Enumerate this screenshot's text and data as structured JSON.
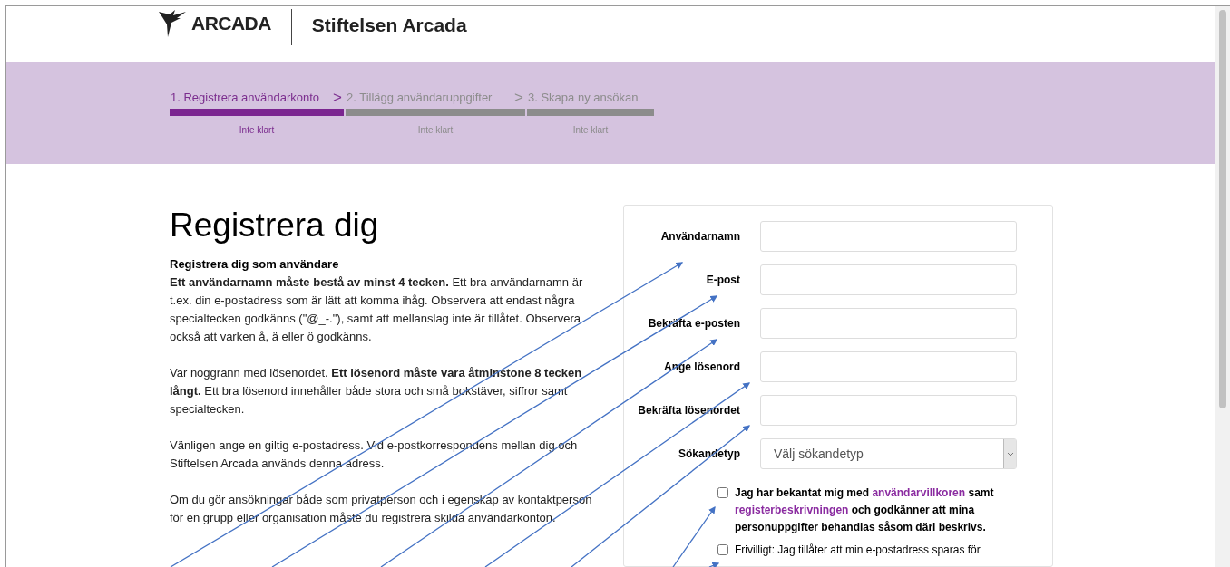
{
  "header": {
    "logo_text": "ARCADA",
    "title": "Stiftelsen Arcada"
  },
  "steps": [
    {
      "label": "1. Registrera användarkonto",
      "status": "Inte klart",
      "selected": true
    },
    {
      "label": "2. Tillägg användaruppgifter",
      "status": "Inte klart",
      "selected": false
    },
    {
      "label": "3. Skapa ny ansökan",
      "status": "Inte klart",
      "selected": false
    }
  ],
  "step_separator": ">",
  "heading": "Registrera dig",
  "intro_title": "Registrera dig som användare",
  "paragraphs": [
    "**Ett användarnamn måste bestå av minst 4 tecken.** Ett bra användarnamn är t.ex. din e-postadress som är lätt att komma ihåg. Observera att endast några specialtecken godkänns (\"@_-.\"), samt att mellanslag inte är tillåtet. Observera också att varken å, ä eller ö godkänns.",
    "Var noggrann med lösenordet. **Ett lösenord måste vara åtminstone 8 tecken långt.** Ett bra lösenord innehåller både stora och små bokstäver, siffror samt specialtecken.",
    "Vänligen ange en giltig e-postadress. Vid e-postkorrespondens mellan dig och Stiftelsen Arcada används denna adress.",
    "Om du gör ansökningar både som privatperson och i egenskap av kontaktperson för en grupp eller organisation måste du registrera skilda användarkonton."
  ],
  "form": {
    "fields": [
      {
        "label": "Användarnamn",
        "kind": "text"
      },
      {
        "label": "E-post",
        "kind": "text"
      },
      {
        "label": "Bekräfta e-posten",
        "kind": "text"
      },
      {
        "label": "Ange lösenord",
        "kind": "text"
      },
      {
        "label": "Bekräfta lösenordet",
        "kind": "text"
      },
      {
        "label": "Sökandetyp",
        "kind": "select",
        "placeholder": "Välj sökandetyp"
      }
    ],
    "consents": [
      {
        "checked": false,
        "bold": true,
        "parts": [
          {
            "kind": "text",
            "text": "Jag har bekantat mig med"
          },
          {
            "kind": "link",
            "text": "användarvillkoren"
          },
          {
            "kind": "text",
            "text": "samt"
          },
          {
            "kind": "link",
            "text": "registerbeskrivningen"
          },
          {
            "kind": "text",
            "text": "och godkänner att mina personuppgifter behandlas såsom däri beskrivs."
          }
        ]
      },
      {
        "checked": false,
        "bold": false,
        "parts": [
          {
            "kind": "text",
            "text": "Frivilligt: Jag tillåter att min e-postadress sparas för"
          }
        ]
      }
    ]
  }
}
